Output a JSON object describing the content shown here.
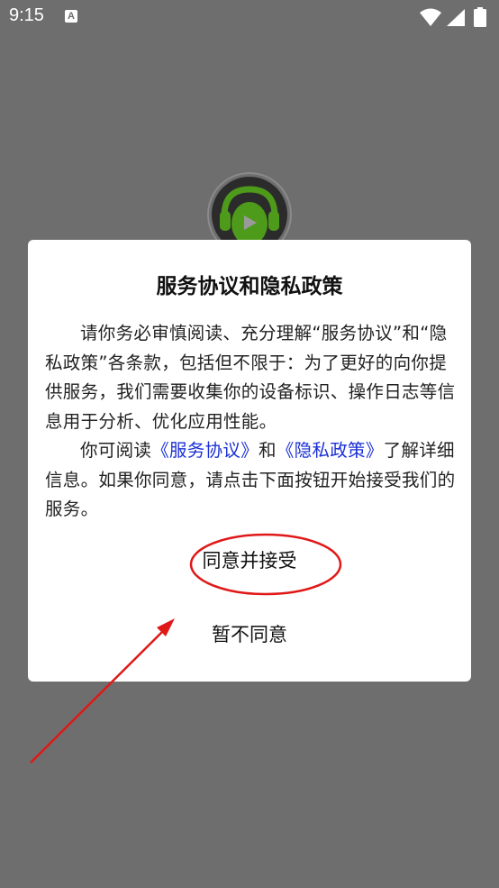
{
  "status_bar": {
    "time": "9:15",
    "notification_icon": "A"
  },
  "dialog": {
    "title": "服务协议和隐私政策",
    "paragraph1": "请你务必审慎阅读、充分理解“服务协议”和“隐私政策”各条款，包括但不限于：为了更好的向你提供服务，我们需要收集你的设备标识、操作日志等信息用于分析、优化应用性能。",
    "paragraph2_prefix": "你可阅读",
    "link_service": "《服务协议》",
    "paragraph2_and": "和",
    "link_privacy": "《隐私政策》",
    "paragraph2_suffix": "了解详细信息。如果你同意，请点击下面按钮开始接受我们的服务。",
    "agree_label": "同意并接受",
    "disagree_label": "暂不同意"
  },
  "colors": {
    "overlay_background": "#6e6e6e",
    "link": "#1a2fd6",
    "annotation": "#e01818",
    "logo_green": "#4e9a1a"
  }
}
